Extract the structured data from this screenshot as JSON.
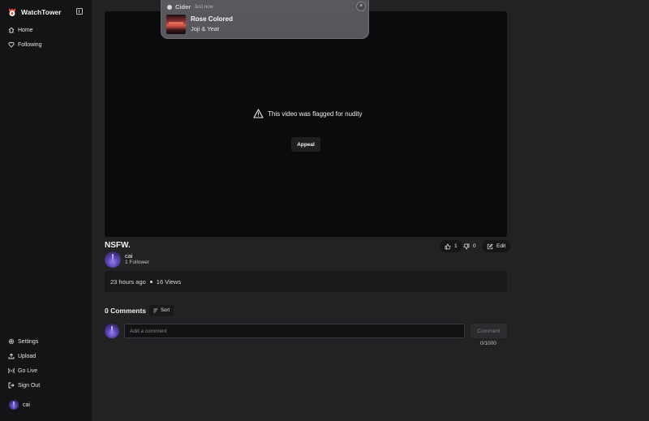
{
  "app": {
    "brand_name": "WatchTower"
  },
  "sidebar": {
    "nav": [
      {
        "label": "Home",
        "icon": "home-icon"
      },
      {
        "label": "Following",
        "icon": "heart-icon"
      }
    ],
    "bottom": [
      {
        "label": "Settings",
        "icon": "gear-icon"
      },
      {
        "label": "Upload",
        "icon": "upload-icon"
      },
      {
        "label": "Go Live",
        "icon": "broadcast-icon"
      },
      {
        "label": "Sign Out",
        "icon": "sign-out-icon"
      }
    ],
    "user": {
      "name": "cai"
    }
  },
  "player": {
    "flag_message": "This video was flagged for nudity",
    "appeal_label": "Appeal"
  },
  "video": {
    "title": "NSFW.",
    "channel_name": "cai",
    "followers": "1 Follower",
    "likes": "1",
    "dislikes": "0",
    "edit_label": "Edit",
    "posted": "23 hours ago",
    "views": "16 Views"
  },
  "comments": {
    "title": "0 Comments",
    "sort_label": "Sort",
    "placeholder": "Add a comment",
    "submit_label": "Comment",
    "char_count": "0/1000"
  },
  "notification": {
    "app": "Cider",
    "time": "Just now",
    "song": "Rose Colored",
    "artist": "Joji & Yeat"
  },
  "colors": {
    "background": "#222224",
    "sidebar": "#141416",
    "player": "#0b0b0d",
    "notification": "#5c5b60"
  }
}
